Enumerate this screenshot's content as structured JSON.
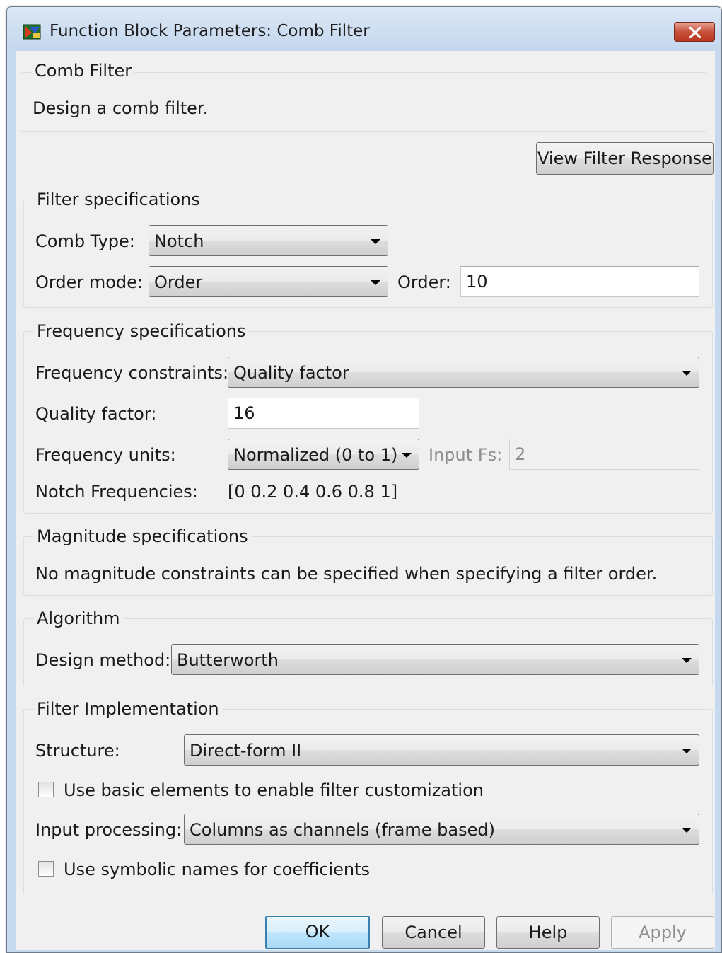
{
  "window": {
    "title": "Function Block Parameters: Comb Filter"
  },
  "header": {
    "group_title": "Comb Filter",
    "description": "Design a comb filter."
  },
  "toolbar": {
    "view_response_label": "View Filter Response"
  },
  "filter_specs": {
    "title": "Filter specifications",
    "comb_type_label": "Comb Type:",
    "comb_type_value": "Notch",
    "order_mode_label": "Order mode:",
    "order_mode_value": "Order",
    "order_label": "Order:",
    "order_value": "10"
  },
  "frequency_specs": {
    "title": "Frequency specifications",
    "constraints_label": "Frequency constraints:",
    "constraints_value": "Quality factor",
    "quality_label": "Quality factor:",
    "quality_value": "16",
    "units_label": "Frequency units:",
    "units_value": "Normalized (0 to 1)",
    "input_fs_label": "Input Fs:",
    "input_fs_value": "2",
    "notch_label": "Notch Frequencies:",
    "notch_value": "[0 0.2 0.4 0.6 0.8 1]"
  },
  "magnitude_specs": {
    "title": "Magnitude specifications",
    "message": "No magnitude constraints can be specified when specifying a filter order."
  },
  "algorithm": {
    "title": "Algorithm",
    "design_method_label": "Design method:",
    "design_method_value": "Butterworth"
  },
  "implementation": {
    "title": "Filter Implementation",
    "structure_label": "Structure:",
    "structure_value": "Direct-form II",
    "basic_elements_label": "Use basic elements to enable filter customization",
    "basic_elements_checked": false,
    "input_processing_label": "Input processing:",
    "input_processing_value": "Columns as channels (frame based)",
    "symbolic_names_label": "Use symbolic names for coefficients",
    "symbolic_names_checked": false
  },
  "buttons": {
    "ok": "OK",
    "cancel": "Cancel",
    "help": "Help",
    "apply": "Apply"
  },
  "colors": {
    "titlebar": "#c6d9ef",
    "dialog_bg": "#f0f0f0",
    "close_button": "#c7503a",
    "default_button_border": "#3c7fb1"
  }
}
